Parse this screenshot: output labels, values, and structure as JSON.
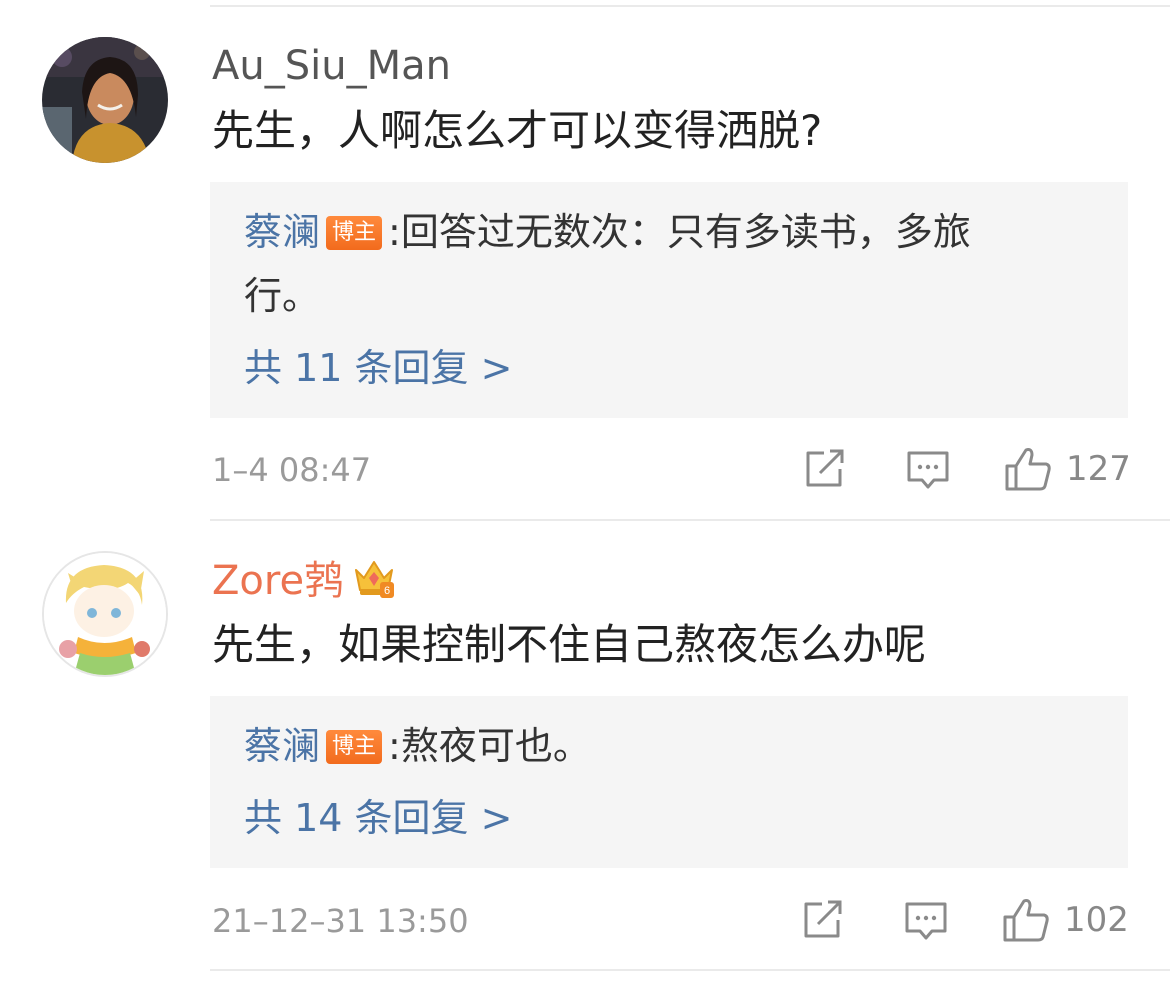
{
  "comments": [
    {
      "username": "Au_Siu_Man",
      "username_color": "#555555",
      "text": "先生，人啊怎么才可以变得洒脱?",
      "reply": {
        "author": "蔡澜",
        "badge": "博主",
        "separator": ":",
        "text_line1": "回答过无数次：只有多读书，多旅",
        "text_line2": "行。",
        "more": "共 11 条回复 >"
      },
      "time": "1–4 08:47",
      "like_count": "127"
    },
    {
      "username": "Zore鹁",
      "username_color": "#eb7350",
      "has_crown_badge": true,
      "text": "先生，如果控制不住自己熬夜怎么办呢",
      "reply": {
        "author": "蔡澜",
        "badge": "博主",
        "separator": ":",
        "text_line1": "熬夜可也。",
        "more": "共 14 条回复 >"
      },
      "time": "21–12–31 13:50",
      "like_count": "102"
    }
  ],
  "icons": {
    "share": "share-icon",
    "comment": "comment-icon",
    "like": "thumbs-up-icon",
    "crown": "crown-badge-icon"
  },
  "colors": {
    "link_blue": "#4b74a6",
    "badge_orange": "#f26b1d",
    "meta_gray": "#9a9a9a"
  }
}
